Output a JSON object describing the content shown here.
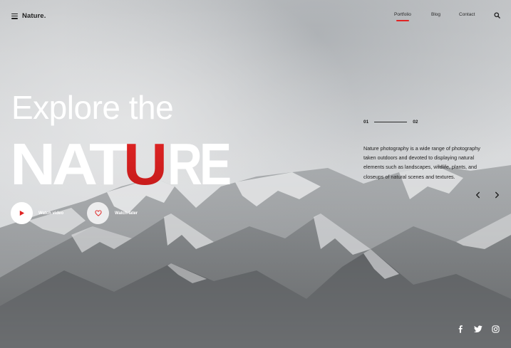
{
  "header": {
    "brand": "Nature.",
    "nav": [
      {
        "label": "Portfolio",
        "active": true
      },
      {
        "label": "Blog",
        "active": false
      },
      {
        "label": "Contact",
        "active": false
      }
    ]
  },
  "hero": {
    "line1": "Explore the",
    "line2_left": "NAT",
    "line2_accent": "U",
    "line2_right": "RE",
    "actions": {
      "watch_video": "Watch video",
      "watch_later": "Watch later"
    }
  },
  "info": {
    "slide_current": "01",
    "slide_next": "02",
    "description": "Nature photography is a wide range of photography taken outdoors and devoted to displaying natural elements such as landscapes, wildlife, plants, and closeups of natural scenes and textures."
  },
  "icons": {
    "menu": "menu-icon",
    "search": "search-icon",
    "play": "play-icon",
    "heart": "heart-icon",
    "prev": "chevron-left-icon",
    "next": "chevron-right-icon",
    "social": [
      "facebook-icon",
      "twitter-icon",
      "instagram-icon"
    ]
  },
  "colors": {
    "accent": "#e02424",
    "text_dark": "#1e1e1e",
    "text_light": "#ffffff"
  }
}
